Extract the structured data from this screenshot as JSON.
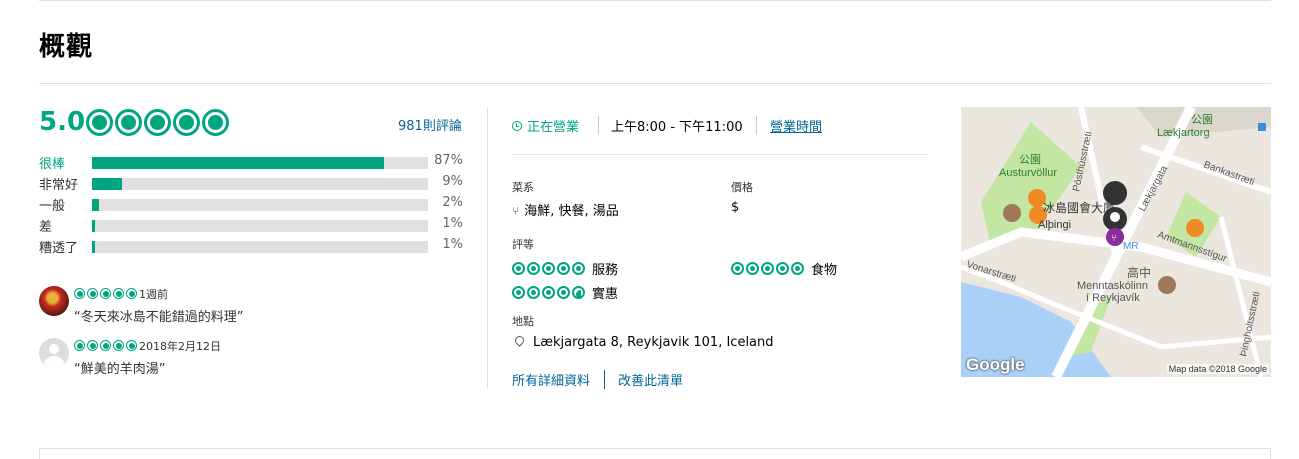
{
  "section_title": "概觀",
  "rating": {
    "score": "5.0",
    "bubbles": 5,
    "review_count_link": "981則評論"
  },
  "breakdown": [
    {
      "label": "很棒",
      "percent_text": "87%",
      "fraction": 0.87,
      "highlight": true
    },
    {
      "label": "非常好",
      "percent_text": "9%",
      "fraction": 0.09,
      "highlight": false
    },
    {
      "label": "一般",
      "percent_text": "2%",
      "fraction": 0.02,
      "highlight": false
    },
    {
      "label": "差",
      "percent_text": "1%",
      "fraction": 0.01,
      "highlight": false
    },
    {
      "label": "糟透了",
      "percent_text": "1%",
      "fraction": 0.01,
      "highlight": false
    }
  ],
  "snippets": [
    {
      "avatar": "user-photo",
      "bubbles": 5,
      "date": "1週前",
      "quote": "“冬天來冰島不能錯過的料理”"
    },
    {
      "avatar": "default-avatar",
      "bubbles": 5,
      "date": "2018年2月12日",
      "quote": "“鮮美的羊肉湯”"
    }
  ],
  "status": {
    "open_label": "正在營業",
    "hours": "上午8:00 - 下午11:00",
    "hours_link": "營業時間"
  },
  "details": {
    "cuisine_label": "菜系",
    "cuisine_value": "海鮮, 快餐, 湯品",
    "price_label": "價格",
    "price_value": "$",
    "ratings_label": "評等",
    "ratings": [
      {
        "name": "服務",
        "bubbles": 5
      },
      {
        "name": "食物",
        "bubbles": 5
      },
      {
        "name": "實惠",
        "bubbles": 4.5
      }
    ],
    "address_label": "地點",
    "address_value": "Lækjargata 8, Reykjavik 101, Iceland"
  },
  "links": {
    "all_details": "所有詳細資料",
    "improve_listing": "改善此清單"
  },
  "map": {
    "labels": {
      "park1": "公園",
      "park1_name": "Lækjartorg",
      "park2": "公園",
      "park2_name": "Austurvöllur",
      "parliament": "冰島國會大廈",
      "althingi": "Alþingi",
      "mr": "MR",
      "school_cn": "高中",
      "school1": "Menntaskólinn",
      "school2": "í Reykjavík",
      "street1": "Pósthússtræti",
      "street2": "Lækjargata",
      "street3": "Bankastræti",
      "street4": "Amtmannsstígur",
      "street5": "Vonarstræti",
      "street6": "Þingholtsstræti"
    },
    "google_logo": "Google",
    "credit": "Map data ©2018 Google",
    "colors": {
      "water": "#aad0f8",
      "park": "#c3e6a3",
      "road": "#ffffff",
      "pin_purple": "#8a2c9c",
      "pin_orange": "#f08a24"
    }
  },
  "colors": {
    "accent": "#00a680",
    "link": "#006699"
  }
}
